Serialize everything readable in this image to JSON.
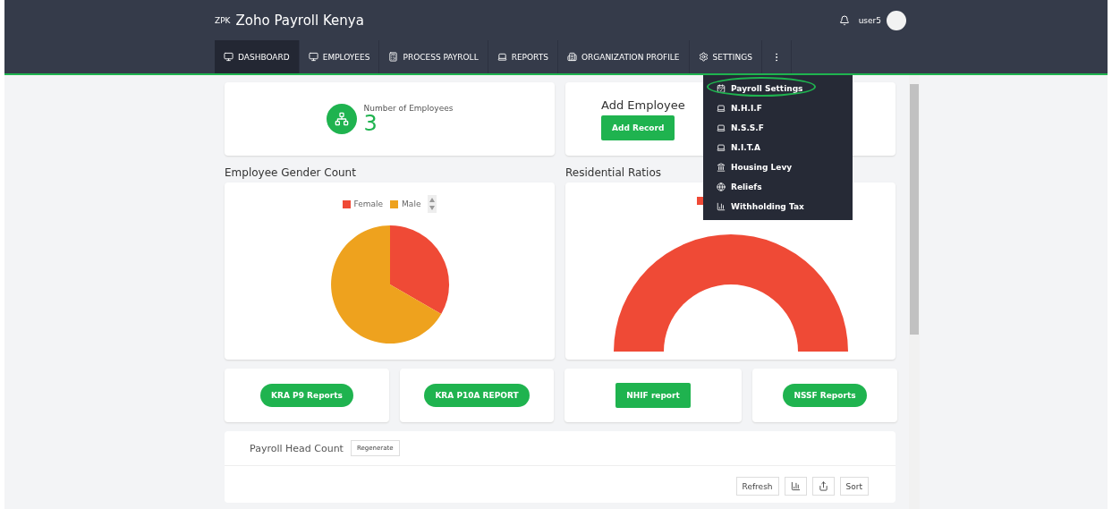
{
  "header": {
    "logo_mark": "ZPK",
    "title": "Zoho Payroll Kenya",
    "user": "user5"
  },
  "nav": [
    {
      "label": "DASHBOARD",
      "selected": true
    },
    {
      "label": "EMPLOYEES",
      "selected": false
    },
    {
      "label": "PROCESS PAYROLL",
      "selected": false
    },
    {
      "label": "REPORTS",
      "selected": false
    },
    {
      "label": "ORGANIZATION PROFILE",
      "selected": false
    },
    {
      "label": "SETTINGS",
      "selected": false
    }
  ],
  "settings_menu": [
    {
      "label": "Payroll Settings",
      "highlighted": true
    },
    {
      "label": "N.H.I.F",
      "highlighted": false
    },
    {
      "label": "N.S.S.F",
      "highlighted": false
    },
    {
      "label": "N.I.T.A",
      "highlighted": false
    },
    {
      "label": "Housing Levy",
      "highlighted": false
    },
    {
      "label": "Reliefs",
      "highlighted": false
    },
    {
      "label": "Withholding Tax",
      "highlighted": false
    }
  ],
  "employee_count": {
    "label": "Number of Employees",
    "value": "3"
  },
  "add_employee": {
    "title": "Add Employee",
    "button": "Add Record"
  },
  "gender_chart": {
    "title": "Employee Gender Count",
    "legend": [
      {
        "label": "Female",
        "color": "#ef4a36"
      },
      {
        "label": "Male",
        "color": "#eea21e"
      }
    ]
  },
  "residential_chart": {
    "title": "Residential Ratios"
  },
  "report_buttons": [
    {
      "label": "KRA P9 Reports",
      "kind": "pill"
    },
    {
      "label": "KRA P10A REPORT",
      "kind": "pill"
    },
    {
      "label": "NHIF report",
      "kind": "square"
    },
    {
      "label": "NSSF Reports",
      "kind": "pill"
    }
  ],
  "head_count": {
    "title": "Payroll Head Count",
    "regenerate": "Regenerate",
    "refresh": "Refresh",
    "sort": "Sort"
  }
}
